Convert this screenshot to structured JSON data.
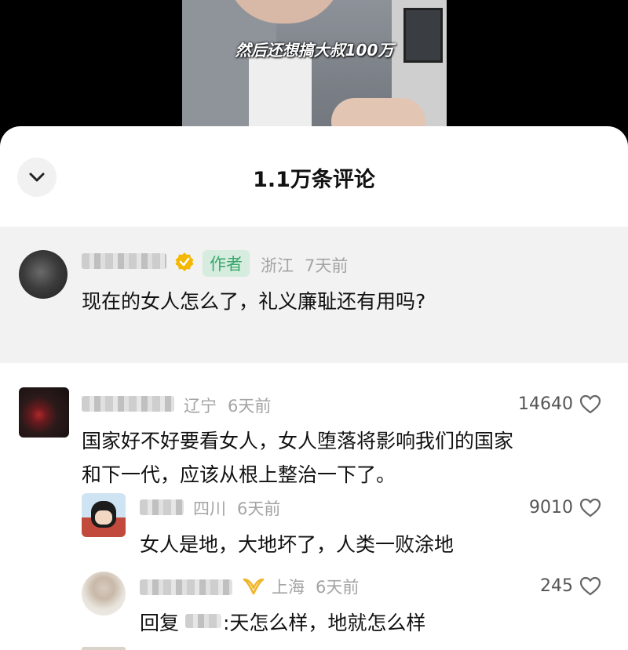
{
  "video": {
    "subtitle": "然后还想搞大叔100万"
  },
  "sheet": {
    "title": "1.1万条评论"
  },
  "pinned_comment": {
    "author_tag": "作者",
    "location": "浙江",
    "time": "7天前",
    "text": "现在的女人怎么了，礼义廉耻还有用吗?"
  },
  "comments": [
    {
      "location": "辽宁",
      "time": "6天前",
      "likes": "14640",
      "text_line1": "国家好不好要看女人，女人堕落将影响我们的国家",
      "text_line2": "和下一代，应该从根上整治一下了。"
    },
    {
      "location": "四川",
      "time": "6天前",
      "likes": "9010",
      "text": "女人是地，大地坏了，人类一败涂地"
    },
    {
      "location": "上海",
      "time": "6天前",
      "likes": "245",
      "reply_prefix": "回复",
      "text": ":天怎么样，地就怎么样"
    }
  ],
  "colors": {
    "author_tag_text": "#3aa76d",
    "author_tag_bg": "#d6ecde",
    "verified_badge": "#f5b800",
    "vip_badge": "#f0b429"
  },
  "icons": [
    "chevron-down-icon",
    "verified-badge-icon",
    "heart-outline-icon",
    "vip-badge-icon"
  ]
}
